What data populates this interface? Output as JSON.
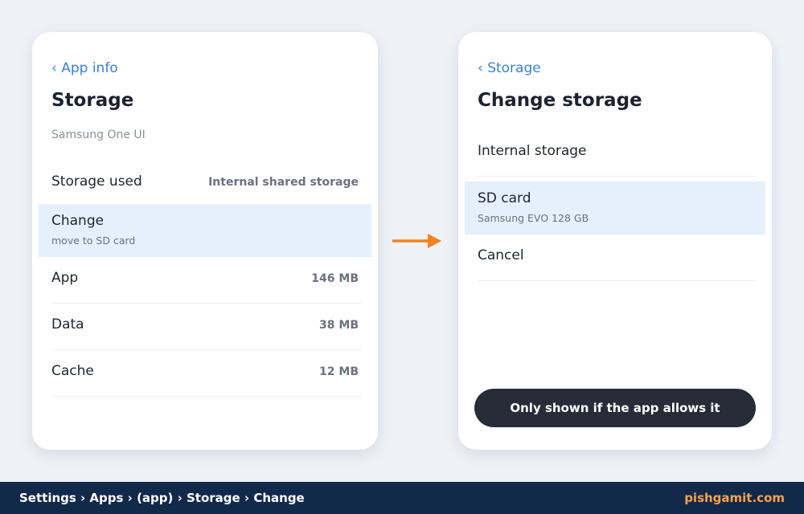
{
  "colors": {
    "background": "#eef1f6",
    "card": "#ffffff",
    "accent_link": "#3b82d0",
    "highlight_row": "#e6effc",
    "arrow": "#f5821f",
    "pill": "#272c38",
    "footer": "#13294a",
    "footer_brand": "#f5a24a"
  },
  "left_card": {
    "back_label": "‹ App info",
    "title": "Storage",
    "subtitle": "Samsung One UI",
    "rows": [
      {
        "label": "Storage used",
        "value": "Internal shared storage"
      },
      {
        "label": "Change",
        "sub": "move to SD card",
        "highlighted": true
      },
      {
        "label": "App",
        "value": "146 MB"
      },
      {
        "label": "Data",
        "value": "38 MB"
      },
      {
        "label": "Cache",
        "value": "12 MB"
      }
    ]
  },
  "flow_arrow_icon": "arrow-right-icon",
  "right_card": {
    "back_label": "‹ Storage",
    "title": "Change storage",
    "options": [
      {
        "label": "Internal storage"
      },
      {
        "label": "SD card",
        "sub": "Samsung EVO 128 GB",
        "highlighted": true
      },
      {
        "label": "Cancel"
      }
    ],
    "note": "Only shown if the app allows it"
  },
  "footer": {
    "path": "Settings › Apps › (app) › Storage › Change",
    "brand": "pishgamit.com"
  }
}
